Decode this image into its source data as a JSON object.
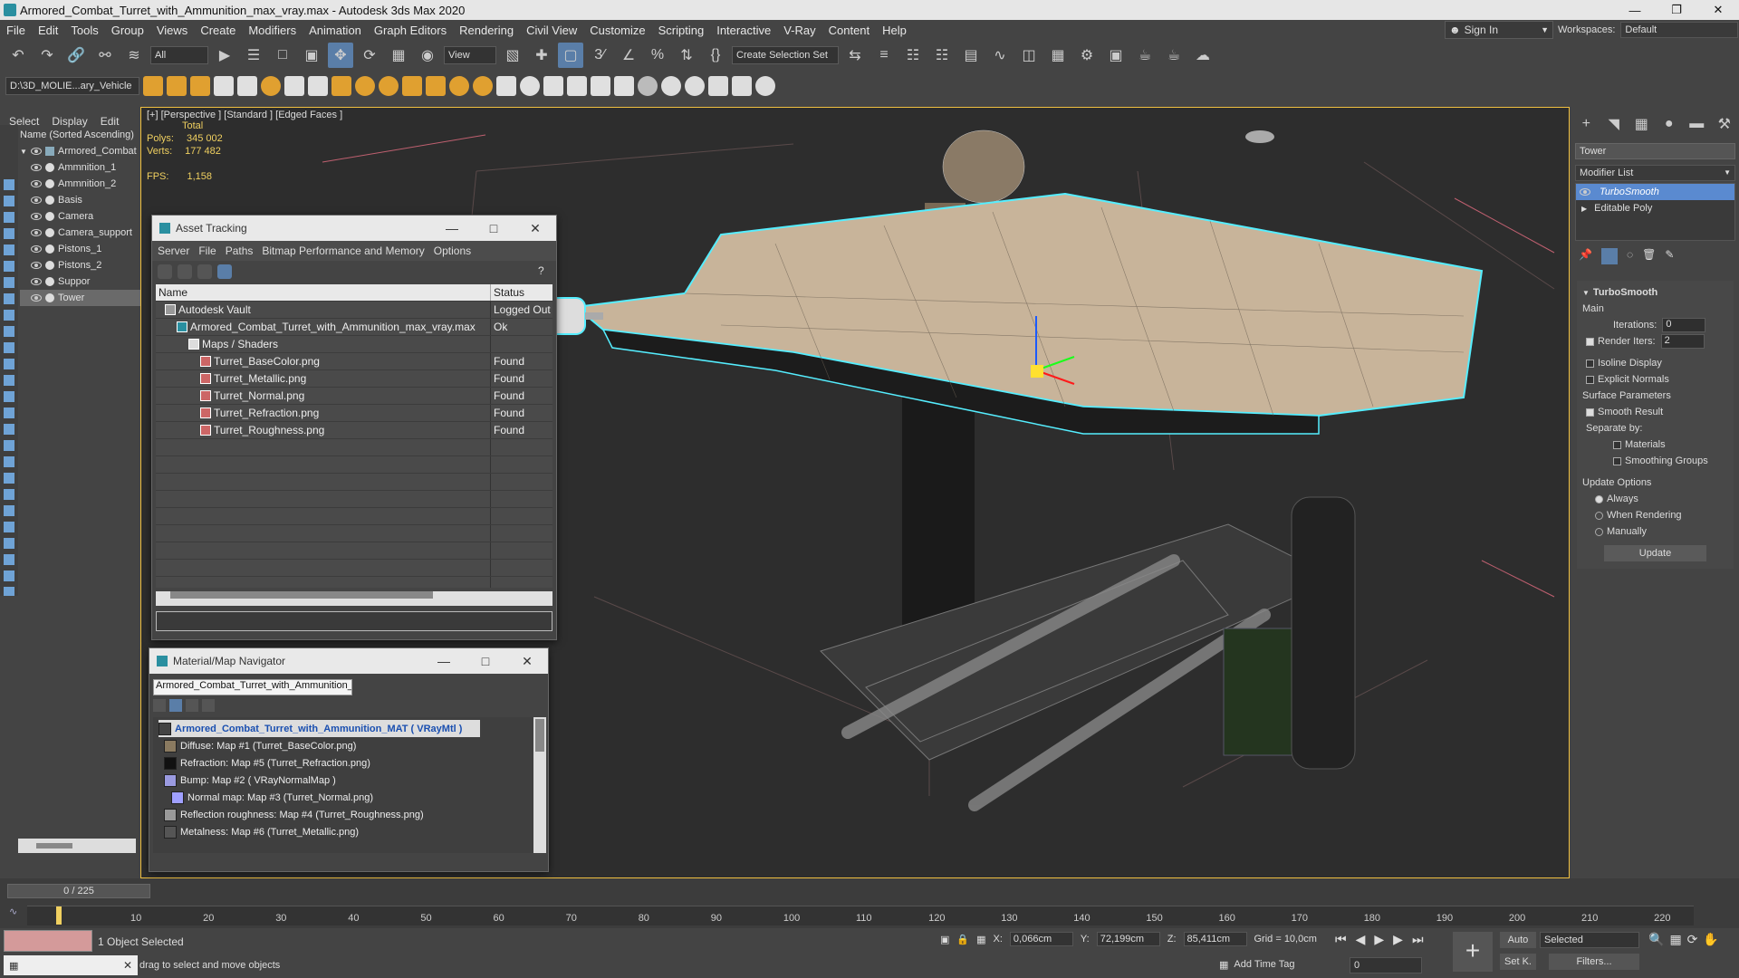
{
  "window": {
    "title": "Armored_Combat_Turret_with_Ammunition_max_vray.max - Autodesk 3ds Max 2020"
  },
  "menu": [
    "File",
    "Edit",
    "Tools",
    "Group",
    "Views",
    "Create",
    "Modifiers",
    "Animation",
    "Graph Editors",
    "Rendering",
    "Civil View",
    "Customize",
    "Scripting",
    "Interactive",
    "V-Ray",
    "Content",
    "Help"
  ],
  "signin": {
    "label": "Sign In"
  },
  "workspaces": {
    "label": "Workspaces:",
    "value": "Default"
  },
  "toolbar": {
    "filter": "All",
    "view": "View",
    "selection_set": "Create Selection Set",
    "path": "D:\\3D_MOLIE...ary_Vehicle"
  },
  "left_menu": [
    "Select",
    "Display",
    "Edit"
  ],
  "scene": {
    "header": "Name (Sorted Ascending)",
    "root": "Armored_Combat",
    "items": [
      "Ammnition_1",
      "Ammnition_2",
      "Basis",
      "Camera",
      "Camera_support",
      "Pistons_1",
      "Pistons_2",
      "Suppor",
      "Tower"
    ],
    "selected": "Tower"
  },
  "viewport": {
    "label": "[+] [Perspective ] [Standard ] [Edged Faces ]",
    "stats_total": "Total",
    "polys_label": "Polys:",
    "polys": "345 002",
    "verts_label": "Verts:",
    "verts": "177 482",
    "fps_label": "FPS:",
    "fps": "1,158"
  },
  "asset_tracking": {
    "title": "Asset Tracking",
    "menu": [
      "Server",
      "File",
      "Paths",
      "Bitmap Performance and Memory",
      "Options"
    ],
    "col_name": "Name",
    "col_status": "Status",
    "rows": [
      {
        "name": "Autodesk Vault",
        "status": "Logged Out (",
        "indent": 0
      },
      {
        "name": "Armored_Combat_Turret_with_Ammunition_max_vray.max",
        "status": "Ok",
        "indent": 1
      },
      {
        "name": "Maps / Shaders",
        "status": "",
        "indent": 2
      },
      {
        "name": "Turret_BaseColor.png",
        "status": "Found",
        "indent": 3
      },
      {
        "name": "Turret_Metallic.png",
        "status": "Found",
        "indent": 3
      },
      {
        "name": "Turret_Normal.png",
        "status": "Found",
        "indent": 3
      },
      {
        "name": "Turret_Refraction.png",
        "status": "Found",
        "indent": 3
      },
      {
        "name": "Turret_Roughness.png",
        "status": "Found",
        "indent": 3
      }
    ]
  },
  "material_nav": {
    "title": "Material/Map Navigator",
    "field": "Armored_Combat_Turret_with_Ammunition_N",
    "root": "Armored_Combat_Turret_with_Ammunition_MAT  ( VRayMtl )",
    "maps": [
      {
        "label": "Diffuse: Map #1 (Turret_BaseColor.png)",
        "color": "#8a7a60"
      },
      {
        "label": "Refraction: Map #5 (Turret_Refraction.png)",
        "color": "#111111"
      },
      {
        "label": "Bump: Map #2  ( VRayNormalMap )",
        "color": "#9a9ae0"
      },
      {
        "label": "Normal map: Map #3 (Turret_Normal.png)",
        "color": "#a0a0ff"
      },
      {
        "label": "Reflection roughness: Map #4 (Turret_Roughness.png)",
        "color": "#999999"
      },
      {
        "label": "Metalness: Map #6 (Turret_Metallic.png)",
        "color": "#555555"
      }
    ]
  },
  "command_panel": {
    "object_name": "Tower",
    "modifier_list": "Modifier List",
    "stack": [
      "TurboSmooth",
      "Editable Poly"
    ],
    "rollout": "TurboSmooth",
    "main": "Main",
    "iterations_label": "Iterations:",
    "iterations": "0",
    "render_iters_label": "Render Iters:",
    "render_iters": "2",
    "isoline": "Isoline Display",
    "explicit": "Explicit Normals",
    "surface_params": "Surface Parameters",
    "smooth_result": "Smooth Result",
    "separate_by": "Separate by:",
    "materials": "Materials",
    "smoothing_groups": "Smoothing Groups",
    "update_options": "Update Options",
    "always": "Always",
    "when_rendering": "When Rendering",
    "manually": "Manually",
    "update_btn": "Update"
  },
  "timeline": {
    "frame": "0 / 225",
    "ticks": [
      "10",
      "20",
      "30",
      "40",
      "50",
      "60",
      "70",
      "80",
      "90",
      "100",
      "110",
      "120",
      "130",
      "140",
      "150",
      "160",
      "170",
      "180",
      "190",
      "200",
      "210",
      "220"
    ]
  },
  "status": {
    "selected": "1 Object Selected",
    "hint": "drag to select and move objects",
    "x_label": "X:",
    "x": "0,066cm",
    "y_label": "Y:",
    "y": "72,199cm",
    "z_label": "Z:",
    "z": "85,411cm",
    "grid": "Grid = 10,0cm",
    "add_time_tag": "Add Time Tag",
    "auto": "Auto",
    "set_k": "Set K.",
    "selected_dd": "Selected",
    "filters": "Filters...",
    "frame_field": "0"
  }
}
